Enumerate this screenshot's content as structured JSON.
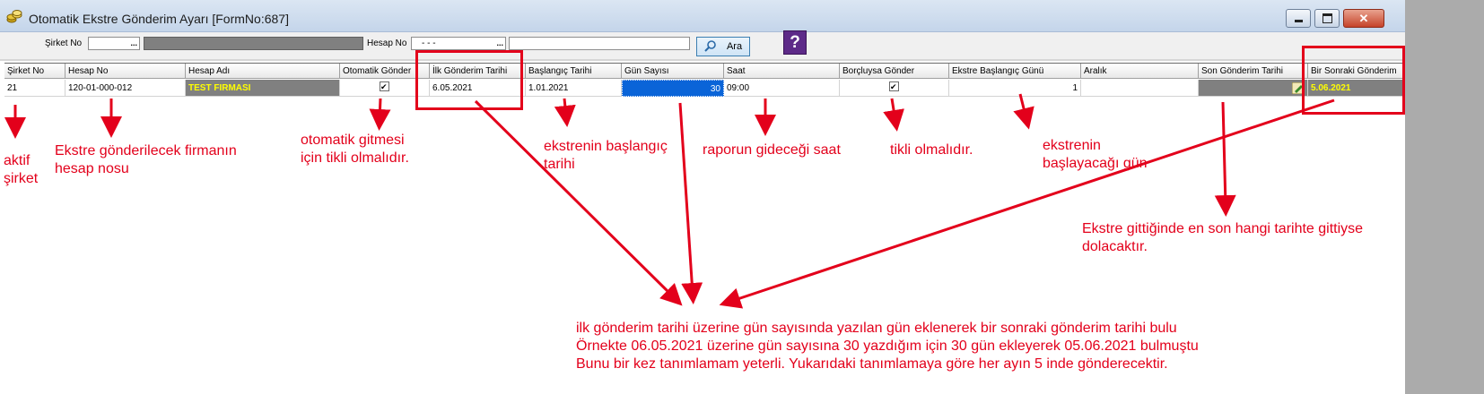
{
  "window": {
    "title": "Otomatik Ekstre Gönderim Ayarı [FormNo:687]"
  },
  "toolbar": {
    "company_label": "Şirket No",
    "company_value": "",
    "account_label": "Hesap No",
    "account_value": "- - -",
    "search_label": "Ara",
    "dots": "..."
  },
  "grid": {
    "columns": [
      "Şirket No",
      "Hesap No",
      "Hesap Adı",
      "Otomatik Gönder",
      "İlk Gönderim Tarihi",
      "Başlangıç Tarihi",
      "Gün Sayısı",
      "Saat",
      "Borçluysa Gönder",
      "Ekstre Başlangıç Günü",
      "Aralık",
      "Son Gönderim Tarihi",
      "Bir Sonraki Gönderim"
    ],
    "row": {
      "company": "21",
      "account": "120-01-000-012",
      "account_name": "TEST FIRMASI",
      "auto_send": true,
      "first_send_date": "6.05.2021",
      "start_date": "1.01.2021",
      "day_count": "30",
      "time": "09:00",
      "send_if_debtor": true,
      "statement_start_day": "1",
      "interval": "",
      "last_send_date": "",
      "next_send_date": "5.06.2021"
    }
  },
  "annotations": {
    "active_company": [
      "aktif",
      "şirket"
    ],
    "account": [
      "Ekstre gönderilecek firmanın",
      "hesap nosu"
    ],
    "auto": [
      "otomatik gitmesi",
      "için tikli olmalıdır."
    ],
    "start": [
      "ekstrenin başlangıç",
      "tarihi"
    ],
    "time": "raporun gideceği saat",
    "debtor": "tikli olmalıdır.",
    "statement_day": [
      "ekstrenin",
      "başlayacağı gün"
    ],
    "last_send": [
      "Ekstre gittiğinde en son hangi tarihte gittiyse",
      "dolacaktır."
    ],
    "bottom": [
      "ilk gönderim tarihi üzerine gün sayısında yazılan gün eklenerek bir sonraki gönderim tarihi bulu",
      "Örnekte 06.05.2021 üzerine gün sayısına 30 yazdığım için 30 gün ekleyerek 05.06.2021 bulmuştu",
      "Bunu bir kez tanımlamam yeterli. Yukarıdaki tanımlamaya göre her ayın 5 inde gönderecektir."
    ]
  },
  "colors": {
    "annotation": "#e3001b",
    "account_name_text": "#ffff00",
    "selected_cell": "#0a64d8",
    "next_date_bg": "#808080"
  }
}
